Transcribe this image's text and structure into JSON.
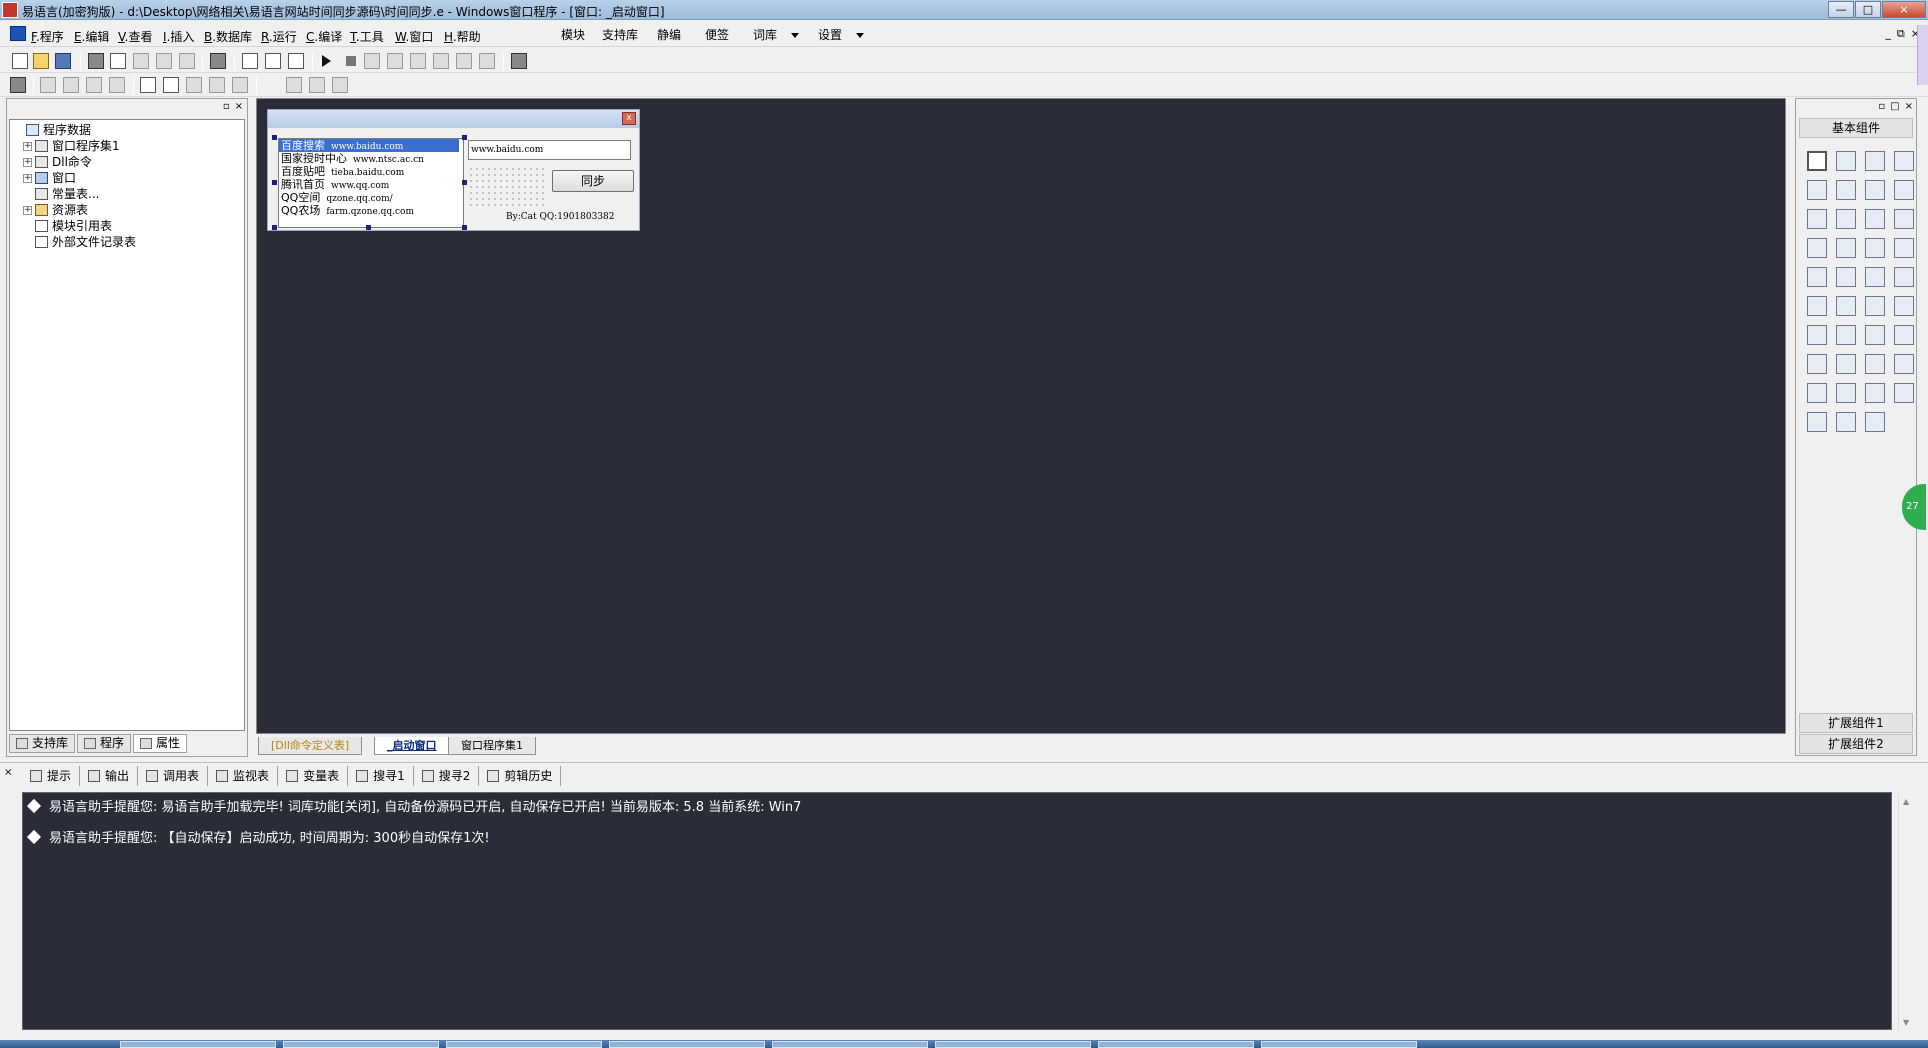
{
  "window": {
    "title": "易语言(加密狗版) - d:\\Desktop\\网络相关\\易语言网站时间同步源码\\时间同步.e - Windows窗口程序 - [窗口: _启动窗口]",
    "controls": [
      "—",
      "□",
      "×"
    ]
  },
  "menu": {
    "items": [
      {
        "mnemonic": "F",
        "label": ".程序"
      },
      {
        "mnemonic": "E",
        "label": ".编辑"
      },
      {
        "mnemonic": "V",
        "label": ".查看"
      },
      {
        "mnemonic": "I",
        "label": ".插入"
      },
      {
        "mnemonic": "B",
        "label": ".数据库"
      },
      {
        "mnemonic": "R",
        "label": ".运行"
      },
      {
        "mnemonic": "C",
        "label": ".编译"
      },
      {
        "mnemonic": "T",
        "label": ".工具"
      },
      {
        "mnemonic": "W",
        "label": ".窗口"
      },
      {
        "mnemonic": "H",
        "label": ".帮助"
      }
    ],
    "plugins": [
      "模块",
      "支持库",
      "静编",
      "便签",
      "词库",
      "设置"
    ],
    "mdi_controls": [
      "_",
      "⧉",
      "×"
    ]
  },
  "left_panel": {
    "tree": [
      {
        "label": "程序数据",
        "level": 0,
        "expander": "",
        "icon": "root-icon"
      },
      {
        "label": "窗口程序集1",
        "level": 1,
        "expander": "+",
        "icon": "module-icon"
      },
      {
        "label": "Dll命令",
        "level": 1,
        "expander": "+",
        "icon": "dll-icon"
      },
      {
        "label": "窗口",
        "level": 1,
        "expander": "+",
        "icon": "window-icon"
      },
      {
        "label": "常量表...",
        "level": 1,
        "expander": "",
        "icon": "constant-icon"
      },
      {
        "label": "资源表",
        "level": 1,
        "expander": "+",
        "icon": "resource-icon"
      },
      {
        "label": "模块引用表",
        "level": 1,
        "expander": "",
        "icon": "page-icon"
      },
      {
        "label": "外部文件记录表",
        "level": 1,
        "expander": "",
        "icon": "page-icon"
      }
    ],
    "tabs": [
      "支持库",
      "程序",
      "属性"
    ]
  },
  "form": {
    "list_items": [
      {
        "name": "百度搜索",
        "url": "www.baidu.com"
      },
      {
        "name": "国家授时中心",
        "url": "www.ntsc.ac.cn"
      },
      {
        "name": "百度贴吧",
        "url": "tieba.baidu.com"
      },
      {
        "name": "腾讯首页",
        "url": "www.qq.com"
      },
      {
        "name": "QQ空间",
        "url": "qzone.qq.com/"
      },
      {
        "name": "QQ农场",
        "url": "farm.qzone.qq.com"
      }
    ],
    "selected_index": 0,
    "url_value": "www.baidu.com",
    "sync_button": "同步",
    "credit": "By:Cat QQ:1901803382",
    "close_glyph": "x"
  },
  "editor_tabs": [
    "[Dll命令定义表]",
    "_启动窗口",
    "窗口程序集1"
  ],
  "right_panel": {
    "title": "基本组件",
    "ext1": "扩展组件1",
    "ext2": "扩展组件2",
    "component_count": 39
  },
  "bottom_panel": {
    "tabs": [
      "提示",
      "输出",
      "调用表",
      "监视表",
      "变量表",
      "搜寻1",
      "搜寻2",
      "剪辑历史"
    ],
    "messages": [
      "易语言助手提醒您:  易语言助手加载完毕! 词库功能[关闭], 自动备份源码已开启, 自动保存已开启!  当前易版本: 5.8  当前系统: Win7",
      "易语言助手提醒您: 【自动保存】启动成功, 时间周期为: 300秒自动保存1次!"
    ]
  },
  "floating_badge": "27",
  "colors": {
    "editor_bg": "#2a2d38",
    "selection": "#3a6fd0",
    "titlebar": "#9ebbd9"
  }
}
